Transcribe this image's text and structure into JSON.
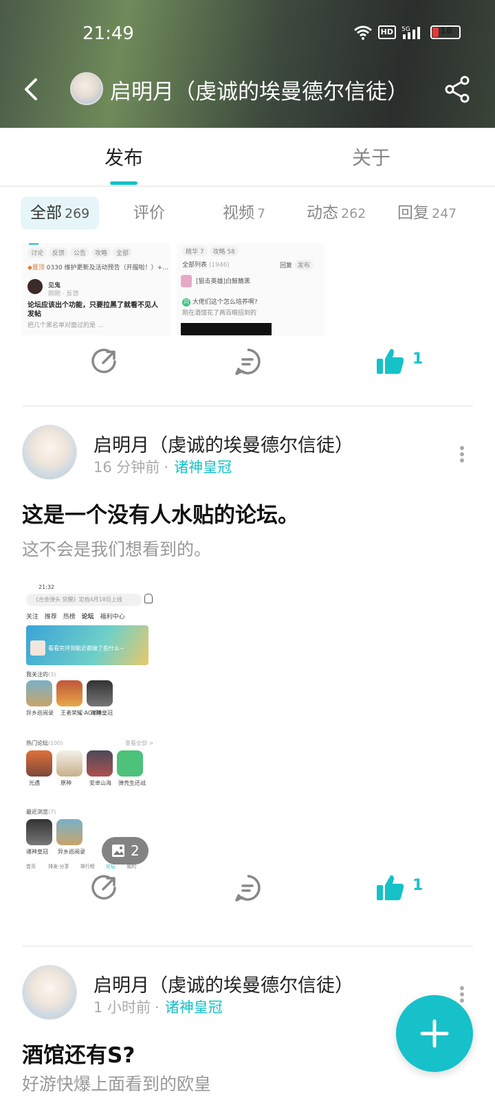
{
  "status": {
    "time": "21:49",
    "hd": "HD",
    "network": "5G",
    "battery": "18"
  },
  "header": {
    "title": "启明月（虔诚的埃曼德尔信徒）"
  },
  "tabs": [
    {
      "label": "发布"
    },
    {
      "label": "关于"
    }
  ],
  "filters": [
    {
      "label": "全部",
      "count": "269"
    },
    {
      "label": "评价",
      "count": ""
    },
    {
      "label": "视频",
      "count": "7"
    },
    {
      "label": "动态",
      "count": "262"
    },
    {
      "label": "回复",
      "count": "247"
    }
  ],
  "thumb1": {
    "pills": [
      "讨论",
      "反馈",
      "公告",
      "攻略",
      "全部"
    ],
    "notice": "0330 维护更新及活动预告（开服啦！）+...",
    "user": "见鬼",
    "sub": "刚刚 · 反馈",
    "title": "论坛应该出个功能，只要拉黑了就看不见人发帖",
    "body": "把几个黑名单对面过的是 ..."
  },
  "thumb2": {
    "pills": [
      "精华 7",
      "攻略 58"
    ],
    "list_label": "全部列表",
    "list_count": "(1946)",
    "sort": "回复",
    "sort2": "发布",
    "user": "[狙击英雄]白鲸鳍黑",
    "question": "大佬们这个怎么培养啊?",
    "answer": "刚在酒馆花了两百眼招到的"
  },
  "post_first_actions": {
    "likes": "1"
  },
  "posts": [
    {
      "author": "启明月（虔诚的埃曼德尔信徒）",
      "time": "16 分钟前",
      "forum": "诸神皇冠",
      "title": "这是一个没有人水贴的论坛。",
      "body": "这不会是我们想看到的。",
      "image_count": "2",
      "likes": "1"
    },
    {
      "author": "启明月（虔诚的埃曼德尔信徒）",
      "time": "1 小时前",
      "forum": "诸神皇冠",
      "title": "酒馆还有S?",
      "body": "好游快爆上面看到的欧皇"
    }
  ],
  "shot": {
    "time": "21:32",
    "search": "《合金弹头 觉醒》定档4月18日上线",
    "tabs": [
      "关注",
      "推荐",
      "热榜",
      "论坛",
      "福利中心"
    ],
    "banner_text": "看看完评测能近都做了些什么~",
    "follow_label": "我关注的",
    "follow_count": "(3)",
    "follow_items": [
      "异乡巡阅录",
      "王者荣耀·AOV随...",
      "诸神皇冠"
    ],
    "hot_label": "热门论坛",
    "hot_count": "(100)",
    "hot_more": "查看全部 >",
    "hot_items": [
      "光遇",
      "原神",
      "安卓山海",
      "弹壳生还战"
    ],
    "recent_label": "最近浏览",
    "recent_count": "(7)",
    "recent_items": [
      "诸神皇冠",
      "异乡巡阅录"
    ],
    "nav": [
      "首页",
      "排发·分享",
      "排行榜",
      "论坛",
      "我的"
    ]
  },
  "colors": {
    "accent": "#14c2c8",
    "fab": "#17c1c9"
  }
}
